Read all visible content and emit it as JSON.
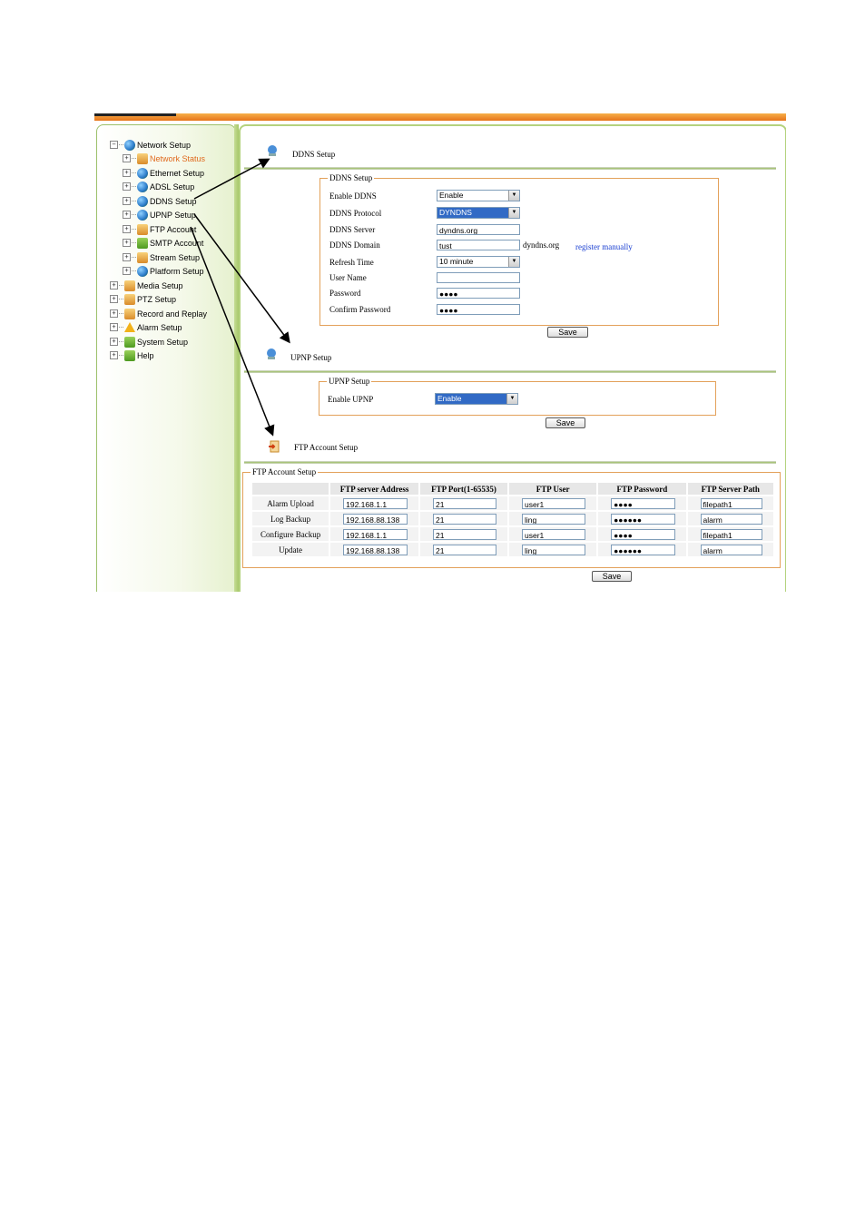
{
  "sidebar": {
    "items": [
      {
        "label": "Network Setup",
        "icon": "globe-icon",
        "toggle": "−"
      },
      {
        "label": "Network Status",
        "icon": "status-icon",
        "toggle": "+",
        "selected": true
      },
      {
        "label": "Ethernet Setup",
        "icon": "globe-icon",
        "toggle": "+"
      },
      {
        "label": "ADSL Setup",
        "icon": "globe-icon",
        "toggle": "+"
      },
      {
        "label": "DDNS Setup",
        "icon": "globe-icon",
        "toggle": "+"
      },
      {
        "label": "UPNP Setup",
        "icon": "globe-icon",
        "toggle": "+"
      },
      {
        "label": "FTP Account",
        "icon": "ftp-icon",
        "toggle": "+"
      },
      {
        "label": "SMTP Account",
        "icon": "smtp-icon",
        "toggle": "+"
      },
      {
        "label": "Stream Setup",
        "icon": "stream-icon",
        "toggle": "+"
      },
      {
        "label": "Platform Setup",
        "icon": "globe-icon",
        "toggle": "+"
      },
      {
        "label": "Media Setup",
        "icon": "media-icon",
        "toggle": "+"
      },
      {
        "label": "PTZ Setup",
        "icon": "ptz-icon",
        "toggle": "+"
      },
      {
        "label": "Record and Replay",
        "icon": "record-icon",
        "toggle": "+"
      },
      {
        "label": "Alarm Setup",
        "icon": "alarm-icon",
        "toggle": "+"
      },
      {
        "label": "System Setup",
        "icon": "system-icon",
        "toggle": "+"
      },
      {
        "label": "Help",
        "icon": "help-icon",
        "toggle": "+"
      }
    ]
  },
  "ddns": {
    "section_title": "DDNS Setup",
    "group_title": "DDNS Setup",
    "enable_label": "Enable DDNS",
    "enable_value": "Enable",
    "protocol_label": "DDNS Protocol",
    "protocol_value": "DYNDNS",
    "server_label": "DDNS Server",
    "server_value": "dyndns.org",
    "domain_label": "DDNS Domain",
    "domain_value": "tust",
    "domain_suffix": "dyndns.org",
    "register_link": "register manually",
    "refresh_label": "Refresh Time",
    "refresh_value": "10 minute",
    "username_label": "User Name",
    "username_value": "",
    "password_label": "Password",
    "password_value": "●●●●",
    "confirm_label": "Confirm Password",
    "confirm_value": "●●●●",
    "save_label": "Save"
  },
  "upnp": {
    "section_title": "UPNP Setup",
    "group_title": "UPNP Setup",
    "enable_label": "Enable UPNP",
    "enable_value": "Enable",
    "save_label": "Save"
  },
  "ftp": {
    "section_title": "FTP Account Setup",
    "group_title": "FTP Account Setup",
    "columns": [
      "",
      "FTP server Address",
      "FTP Port(1-65535)",
      "FTP User",
      "FTP Password",
      "FTP Server Path"
    ],
    "rows": [
      {
        "name": "Alarm Upload",
        "address": "192.168.1.1",
        "port": "21",
        "user": "user1",
        "password": "●●●●",
        "path": "filepath1"
      },
      {
        "name": "Log Backup",
        "address": "192.168.88.138",
        "port": "21",
        "user": "ling",
        "password": "●●●●●●",
        "path": "alarm"
      },
      {
        "name": "Configure Backup",
        "address": "192.168.1.1",
        "port": "21",
        "user": "user1",
        "password": "●●●●",
        "path": "filepath1"
      },
      {
        "name": "Update",
        "address": "192.168.88.138",
        "port": "21",
        "user": "ling",
        "password": "●●●●●●",
        "path": "alarm"
      }
    ],
    "save_label": "Save"
  },
  "colors": {
    "accent_orange": "#e7741a",
    "sidebar_green": "#a6c86a",
    "group_border": "#e3a15a",
    "selected_text": "#e06a1e",
    "link_blue": "#1a3fd1",
    "highlight_blue": "#316ac5"
  }
}
